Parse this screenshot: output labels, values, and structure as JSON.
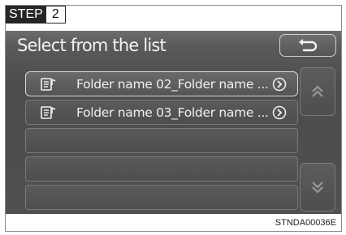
{
  "step": {
    "label": "STEP",
    "number": "2"
  },
  "screen": {
    "title": "Select from the list",
    "back_icon": "back-arrow-icon",
    "list_items": [
      {
        "label": "Folder name 02_Folder name ...",
        "icon": "folder-music-icon",
        "arrow_icon": "circle-arrow-right-icon",
        "selected": true
      },
      {
        "label": "Folder name 03_Folder name ...",
        "icon": "folder-music-icon",
        "arrow_icon": "circle-arrow-right-icon",
        "selected": false
      },
      {
        "label": ""
      },
      {
        "label": ""
      },
      {
        "label": ""
      }
    ],
    "scroll_up_icon": "double-chevron-up-icon",
    "scroll_down_icon": "double-chevron-down-icon"
  },
  "credit": "STNDA00036E",
  "colors": {
    "screen_bg": "#4f4f4f",
    "text": "#f0f0f0",
    "step_bg": "#262626"
  }
}
